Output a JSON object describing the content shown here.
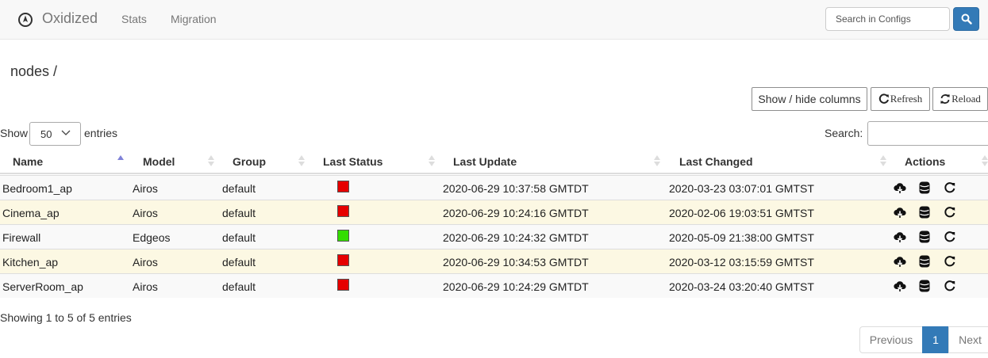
{
  "navbar": {
    "brand": "Oxidized",
    "links": {
      "stats": "Stats",
      "migration": "Migration"
    },
    "search_placeholder": "Search in Configs",
    "search_icon": "search-icon"
  },
  "breadcrumb": "nodes /",
  "toolbar": {
    "show_hide_columns": "Show / hide columns",
    "refresh": "Refresh",
    "reload": "Reload"
  },
  "length": {
    "show_label": "Show",
    "value": "50",
    "entries_label": "entries"
  },
  "search_label": "Search:",
  "table": {
    "headers": {
      "name": "Name",
      "model": "Model",
      "group": "Group",
      "last_status": "Last Status",
      "last_update": "Last Update",
      "last_changed": "Last Changed",
      "actions": "Actions"
    },
    "rows": [
      {
        "name": "Bedroom1_ap",
        "model": "Airos",
        "group": "default",
        "status": "failed",
        "status_color": "#e60000",
        "last_update": "2020-06-29 10:37:58 GMTDT",
        "last_changed": "2020-03-23 03:07:01 GMTST"
      },
      {
        "name": "Cinema_ap",
        "model": "Airos",
        "group": "default",
        "status": "failed",
        "status_color": "#e60000",
        "last_update": "2020-06-29 10:24:16 GMTDT",
        "last_changed": "2020-02-06 19:03:51 GMTST"
      },
      {
        "name": "Firewall",
        "model": "Edgeos",
        "group": "default",
        "status": "success",
        "status_color": "#33dd00",
        "last_update": "2020-06-29 10:24:32 GMTDT",
        "last_changed": "2020-05-09 21:38:00 GMTST"
      },
      {
        "name": "Kitchen_ap",
        "model": "Airos",
        "group": "default",
        "status": "failed",
        "status_color": "#e60000",
        "last_update": "2020-06-29 10:34:53 GMTDT",
        "last_changed": "2020-03-12 03:15:59 GMTST"
      },
      {
        "name": "ServerRoom_ap",
        "model": "Airos",
        "group": "default",
        "status": "failed",
        "status_color": "#e60000",
        "last_update": "2020-06-29 10:24:29 GMTDT",
        "last_changed": "2020-03-24 03:20:40 GMTST"
      }
    ],
    "action_icons": [
      "cloud-download-icon",
      "database-icon",
      "refresh-icon"
    ]
  },
  "info": "Showing 1 to 5 of 5 entries",
  "pagination": {
    "previous": "Previous",
    "current": "1",
    "next": "Next"
  },
  "colors": {
    "primary": "#337ab7",
    "row_alt": "#fcf8e3",
    "row_base": "#f9f9f9"
  }
}
